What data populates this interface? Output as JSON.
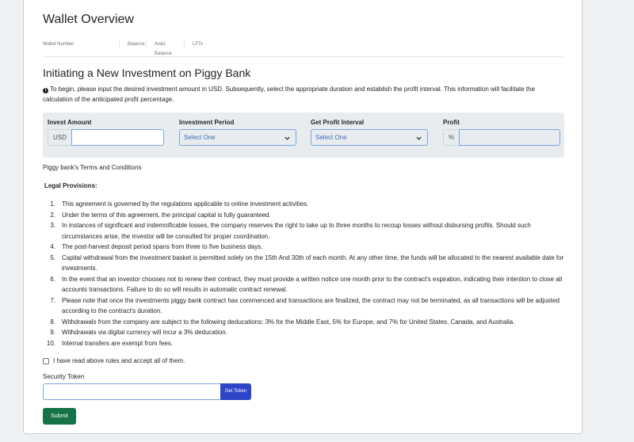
{
  "wallet": {
    "title": "Wallet Overview",
    "stats": [
      "Wallet Number",
      "Balance",
      "Avail. Balance",
      "LFTs"
    ]
  },
  "investment": {
    "title": "Initiating a New Investment on Piggy Bank",
    "intro": "To begin, please input the desired investment amount in USD. Subsequently, select the appropriate duration and establish the profit interval. This information will facilitate the calculation of the anticipated profit percentage.",
    "form": {
      "amount_label": "Invest Amount",
      "amount_addon": "USD",
      "amount_value": "",
      "period_label": "Investment Period",
      "period_value": "Select One",
      "interval_label": "Get Profit Interval",
      "interval_value": "Select One",
      "profit_label": "Profit",
      "profit_addon": "%",
      "profit_value": ""
    }
  },
  "terms": {
    "heading": "Piggy bank's Terms and Conditions",
    "legal_heading": "Legal Provisions:",
    "rules": [
      {
        "num": "1.",
        "text": "This agreement is governed by the regulations applicable to online investment activities."
      },
      {
        "num": "2.",
        "text": "Under the terms of this agreement, the principal capital is fully guaranteed."
      },
      {
        "num": "3.",
        "text": "In instances of significant and indemnificable losses, the company reserves the right to take up to three months to recoup losses without disbursing profits. Should such circumstances arise, the investor will be consulted for proper coordination."
      },
      {
        "num": "4.",
        "text": "The post-harvest deposit period spans from three to five business days."
      },
      {
        "num": "5.",
        "text": "Capital withdrawal from the investment basket is permitted solely on the 15th And 30th of each month. At any other time, the funds will be allocated to the nearest available date for investments."
      },
      {
        "num": "6.",
        "text": "In the event that an investor chooses not to renew their contract, they must provide a written notice one month prior to the contract's expiration, indicating their intention to close all accounts transactions. Failure to do so will results in automatic contract renewal."
      },
      {
        "num": "7.",
        "text": "Please note that once the investments piggy bank contract has commenced and transactions are finalized, the contract may not be terminated, as all transactions will be adjusted according to the contract's duration."
      },
      {
        "num": "8.",
        "text": "Withdrawals from the company are subject to the following deducations: 3% for the Middle East, 5% for Europe, and 7% for United States, Canada, and Australia."
      },
      {
        "num": "9.",
        "text": "Withdrawals via digital currency  will incur a 3% deducation."
      },
      {
        "num": "10.",
        "text": "Internal transfers are exempt from fees."
      }
    ],
    "accept_label": "I have read above rules and accept all of them."
  },
  "security": {
    "label": "Security Token",
    "value": "",
    "get_token_label": "Get Token",
    "submit_label": "Submit"
  },
  "colors": {
    "accent_blue": "#2d45c8",
    "submit_green": "#157347",
    "panel_gray": "#e9ecef"
  },
  "icons": [
    "info-icon",
    "chevron-down-icon"
  ]
}
